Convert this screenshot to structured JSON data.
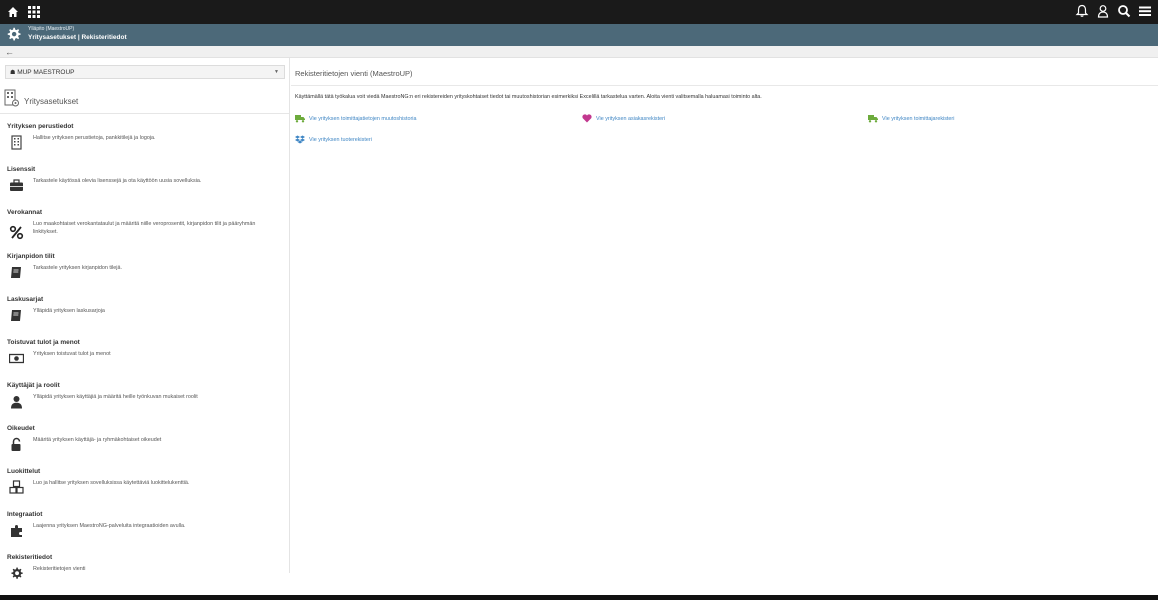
{
  "topbar": {
    "left_icons": [
      "home-icon",
      "apps-grid-icon"
    ],
    "right_icons": [
      "bell-icon",
      "user-icon",
      "search-icon",
      "menu-icon"
    ]
  },
  "header": {
    "subtitle": "Ylläpito (MaestroUP)",
    "title": "Yritysasetukset | Rekisteritiedot"
  },
  "sidebar": {
    "company": "MUP MAESTROUP",
    "heading": "Yritysasetukset",
    "sections": [
      {
        "name": "Yrityksen perustiedot",
        "desc": "Hallitse yrityksen perustietoja, pankkitilejä ja logoja.",
        "icon": "building-icon"
      },
      {
        "name": "Lisenssit",
        "desc": "Tarkastele käytössä olevia lisenssejä ja ota käyttöön uusia sovelluksia.",
        "icon": "briefcase-icon"
      },
      {
        "name": "Verokannat",
        "desc": "Luo maakohtaiset verokantataulut ja määritä niille veroprosentit, kirjanpidon tilit ja pääryhmän linkitykset.",
        "icon": "percent-icon"
      },
      {
        "name": "Kirjanpidon tilit",
        "desc": "Tarkastele yrityksen kirjanpidon tilejä.",
        "icon": "book-icon"
      },
      {
        "name": "Laskusarjat",
        "desc": "Ylläpidä yrityksen laskusarjoja",
        "icon": "book-icon"
      },
      {
        "name": "Toistuvat tulot ja menot",
        "desc": "Yrityksen toistuvat tulot ja menot",
        "icon": "money-icon"
      },
      {
        "name": "Käyttäjät ja roolit",
        "desc": "Ylläpidä yrityksen käyttäjiä ja määritä heille työnkuvan mukaiset roolit",
        "icon": "user-icon"
      },
      {
        "name": "Oikeudet",
        "desc": "Määritä yrityksen käyttäjä- ja ryhmäkohtaiset oikeudet",
        "icon": "unlock-icon"
      },
      {
        "name": "Luokittelut",
        "desc": "Luo ja hallitse yrityksen sovelluksissa käytettäviä luokittelukenttiä.",
        "icon": "cubes-icon"
      },
      {
        "name": "Integraatiot",
        "desc": "Laajenna yrityksen MaestroNG-palveluita integraatioiden avulla.",
        "icon": "puzzle-icon"
      },
      {
        "name": "Rekisteritiedot",
        "desc": "Rekisteritietojen vienti",
        "icon": "gear-icon"
      }
    ]
  },
  "content": {
    "title": "Rekisteritietojen vienti (MaestroUP)",
    "intro": "Käyttämällä tätä työkalua voit viedä MaestroNG:n eri rekistereiden yrityskohtaiset tiedot tai muutoshistorian esimerkiksi Excelillä tarkastelua varten. Aloita vienti valitsemalla haluamasi toiminto alta.",
    "links": [
      {
        "label": "Vie yrityksen toimittajatietojen muutoshistoria",
        "icon": "truck-icon",
        "color": "#6dab3c"
      },
      {
        "label": "Vie yrityksen asiakasrekisteri",
        "icon": "heart-icon",
        "color": "#c2388f"
      },
      {
        "label": "Vie yrityksen toimittajarekisteri",
        "icon": "truck-icon",
        "color": "#6dab3c"
      },
      {
        "label": "Vie yrityksen tuoterekisteri",
        "icon": "dropbox-icon",
        "color": "#3f86c4"
      }
    ]
  }
}
